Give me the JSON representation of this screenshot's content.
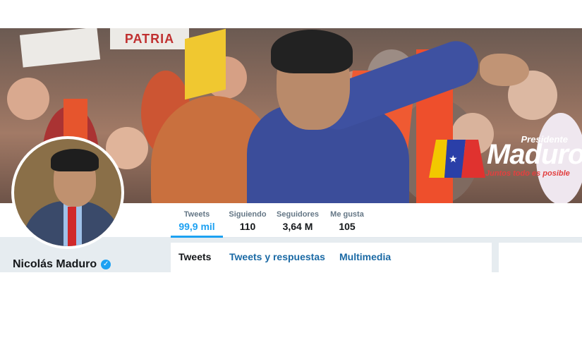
{
  "banner": {
    "sign_text": "PATRIA",
    "logo": {
      "subtitle": "Presidente",
      "word": "Maduro",
      "slogan": "Juntos todo es posible",
      "colors": {
        "yellow": "#f2c800",
        "blue": "#2a3fa8",
        "red": "#e0322f"
      }
    }
  },
  "profile": {
    "name": "Nicolás Maduro",
    "verified_icon": "verified-badge-icon"
  },
  "stats": [
    {
      "label": "Tweets",
      "value": "99,9 mil"
    },
    {
      "label": "Siguiendo",
      "value": "110"
    },
    {
      "label": "Seguidores",
      "value": "3,64 M"
    },
    {
      "label": "Me gusta",
      "value": "105"
    }
  ],
  "tabs": [
    {
      "label": "Tweets"
    },
    {
      "label": "Tweets y respuestas"
    },
    {
      "label": "Multimedia"
    }
  ],
  "colors": {
    "accent": "#1da1f2",
    "background": "#e6ecf0"
  }
}
